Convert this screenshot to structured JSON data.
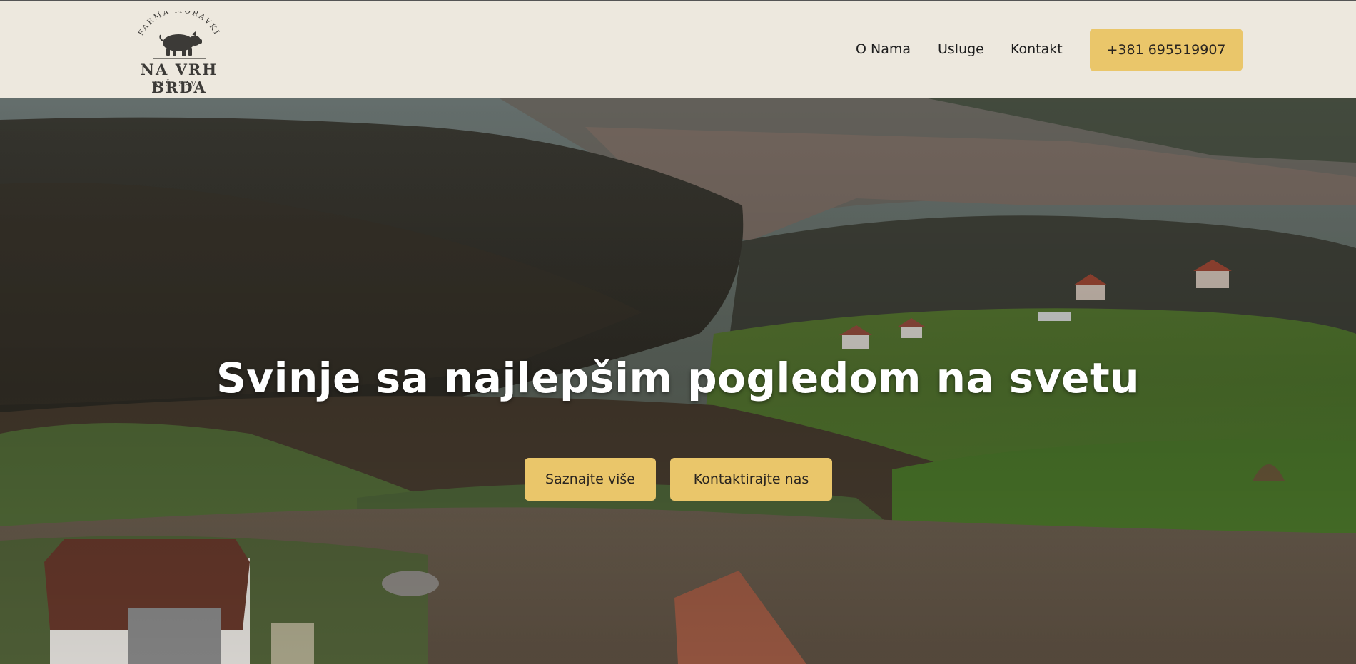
{
  "header": {
    "logo": {
      "arc_text": "FARMA MORAVKI",
      "name": "NA VRH BRDA",
      "subtitle": "VIŠESAVA",
      "icon": "pig-icon"
    },
    "nav": [
      {
        "label": "O Nama"
      },
      {
        "label": "Usluge"
      },
      {
        "label": "Kontakt"
      }
    ],
    "phone_button": {
      "label": "+381 695519907"
    }
  },
  "hero": {
    "title": "Svinje sa najlepšim pogledom na svetu",
    "buttons": [
      {
        "label": "Saznajte više"
      },
      {
        "label": "Kontaktirajte nas"
      }
    ]
  },
  "colors": {
    "header_bg": "#ede8de",
    "accent": "#eac66a",
    "text_dark": "#1d1d1d",
    "hero_text": "#ffffff"
  }
}
